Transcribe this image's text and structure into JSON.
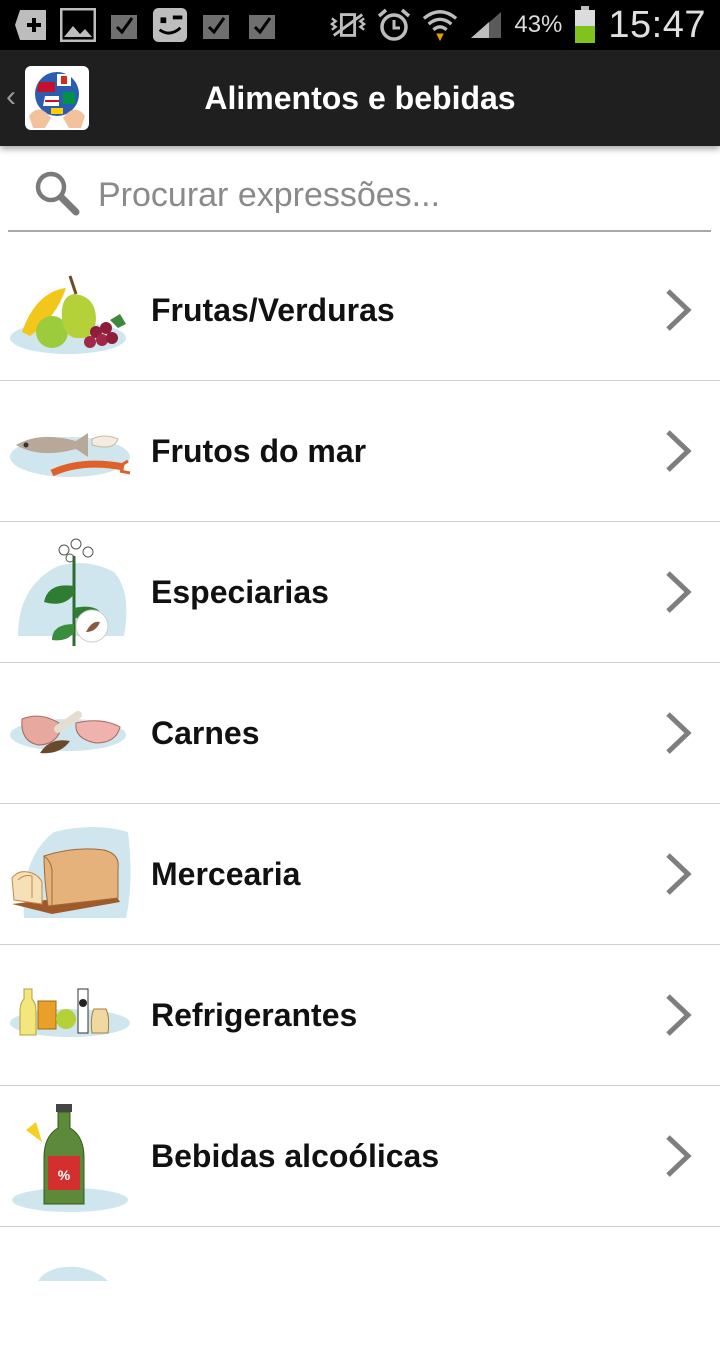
{
  "status_bar": {
    "battery_percent": "43%",
    "clock": "15:47",
    "icons": [
      "add-icon",
      "image-icon",
      "checkbox-icon",
      "smiley-icon",
      "checkbox-icon",
      "checkbox-icon",
      "vibrate-icon",
      "alarm-icon",
      "wifi-icon",
      "signal-icon",
      "battery-icon"
    ]
  },
  "header": {
    "title": "Alimentos e bebidas",
    "back_glyph": "‹"
  },
  "search": {
    "placeholder": "Procurar expressões..."
  },
  "categories": [
    {
      "label": "Frutas/Verduras",
      "icon": "fruits-icon"
    },
    {
      "label": "Frutos do mar",
      "icon": "seafood-icon"
    },
    {
      "label": "Especiarias",
      "icon": "herbs-icon"
    },
    {
      "label": "Carnes",
      "icon": "meat-icon"
    },
    {
      "label": "Mercearia",
      "icon": "bread-icon"
    },
    {
      "label": "Refrigerantes",
      "icon": "soft-drinks-icon"
    },
    {
      "label": "Bebidas alcoólicas",
      "icon": "alcohol-bottle-icon"
    }
  ],
  "colors": {
    "status_bar_bg": "#000000",
    "action_bar_bg": "#1f1f1f",
    "battery_fill": "#7fc31c",
    "icon_splash": "#cfe6ee"
  }
}
